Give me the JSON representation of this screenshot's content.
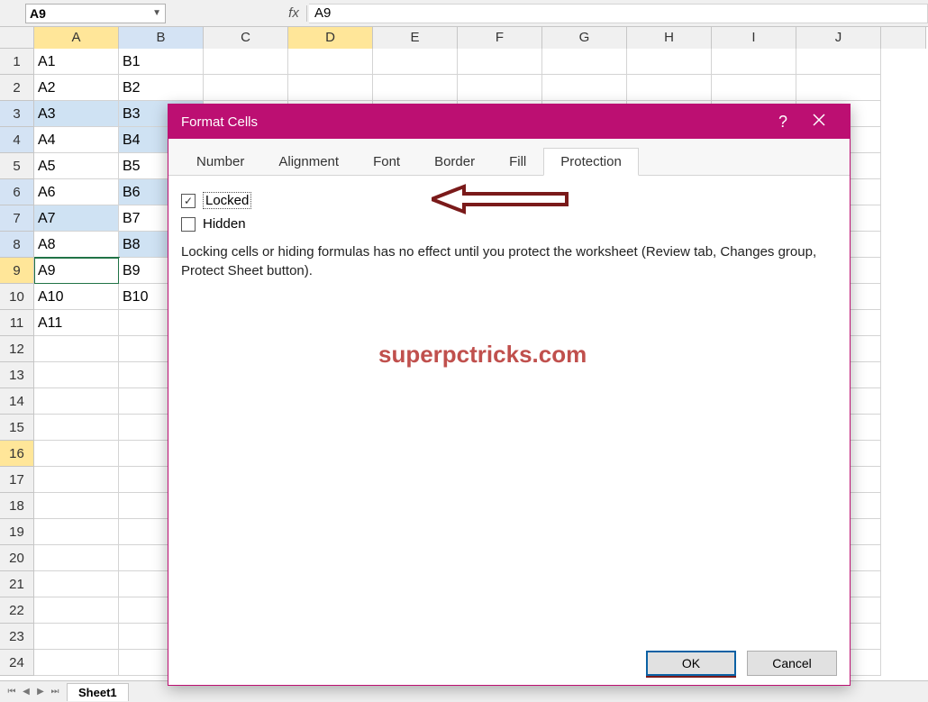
{
  "namebox": {
    "value": "A9"
  },
  "formula_bar": {
    "fx_label": "fx",
    "value": "A9"
  },
  "columns": [
    "A",
    "B",
    "C",
    "D",
    "E",
    "F",
    "G",
    "H",
    "I",
    "J"
  ],
  "col_state": {
    "A": "sel",
    "B": "partial",
    "D": "sel"
  },
  "row_state": {
    "3": "partial",
    "4": "partial",
    "6": "partial",
    "7": "partial",
    "8": "partial",
    "9": "sel",
    "16": "sel"
  },
  "grid": {
    "rows": 24,
    "cells": {
      "A1": "A1",
      "B1": "B1",
      "A2": "A2",
      "B2": "B2",
      "A3": "A3",
      "B3": "B3",
      "A4": "A4",
      "B4": "B4",
      "A5": "A5",
      "B5": "B5",
      "A6": "A6",
      "B6": "B6",
      "A7": "A7",
      "B7": "B7",
      "A8": "A8",
      "B8": "B8",
      "A9": "A9",
      "B9": "B9",
      "A10": "A10",
      "B10": "B10",
      "A11": "A11"
    },
    "selected_blue": [
      "A3",
      "B3",
      "B4",
      "B6",
      "A7",
      "B8"
    ],
    "active_cell": "A9"
  },
  "sheet_tab": {
    "name": "Sheet1"
  },
  "dialog": {
    "title": "Format Cells",
    "tabs": [
      "Number",
      "Alignment",
      "Font",
      "Border",
      "Fill",
      "Protection"
    ],
    "active_tab": "Protection",
    "locked_label": "Locked",
    "hidden_label": "Hidden",
    "locked_checked": true,
    "hidden_checked": false,
    "info": "Locking cells or hiding formulas has no effect until you protect the worksheet (Review tab, Changes group, Protect Sheet button).",
    "ok_label": "OK",
    "cancel_label": "Cancel"
  },
  "watermark": "superpctricks.com"
}
